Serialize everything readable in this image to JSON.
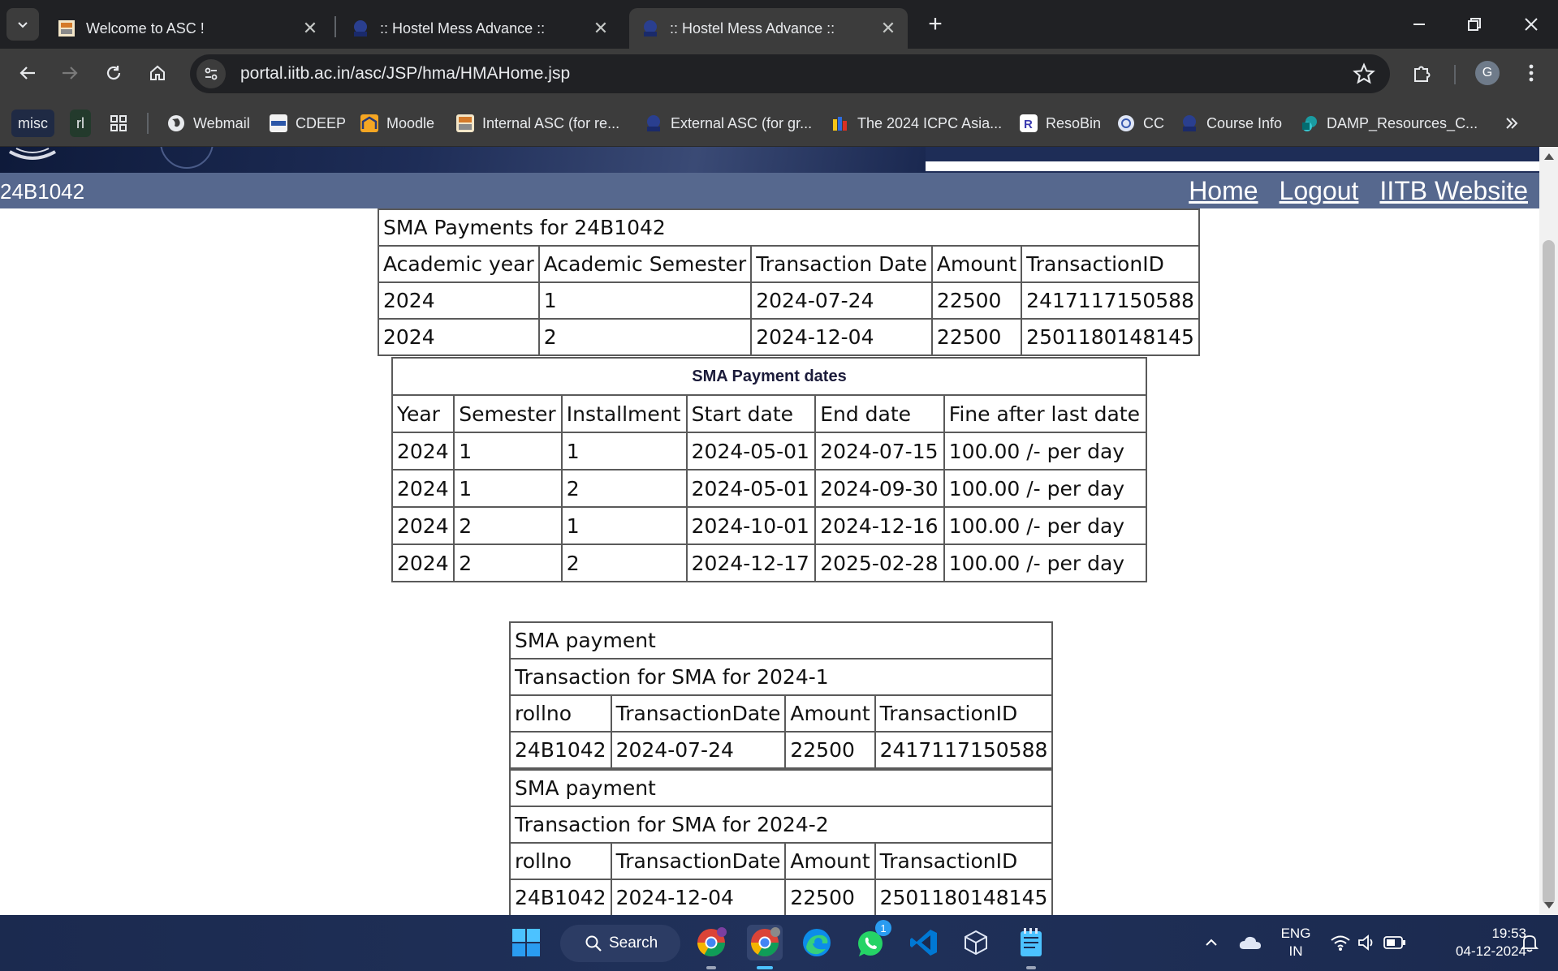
{
  "browser": {
    "tabs": [
      {
        "title": "Welcome to ASC !",
        "active": false
      },
      {
        "title": ":: Hostel Mess Advance ::",
        "active": false
      },
      {
        "title": ":: Hostel Mess Advance ::",
        "active": true
      }
    ],
    "url": "portal.iitb.ac.in/asc/JSP/hma/HMAHome.jsp",
    "profile_initial": "G",
    "bookmarks": [
      "misc",
      "rl",
      "Webmail",
      "CDEEP",
      "Moodle",
      "Internal ASC (for re...",
      "External ASC (for gr...",
      "The 2024 ICPC Asia...",
      "ResoBin",
      "CC",
      "Course Info",
      "DAMP_Resources_C..."
    ]
  },
  "header": {
    "roll_no": "24B1042",
    "links": [
      "Home",
      "Logout",
      "IITB Website"
    ]
  },
  "payments": {
    "title": "SMA Payments for 24B1042",
    "headers": [
      "Academic year",
      "Academic Semester",
      "Transaction Date",
      "Amount",
      "TransactionID"
    ],
    "rows": [
      [
        "2024",
        "1",
        "2024-07-24",
        "22500",
        "2417117150588"
      ],
      [
        "2024",
        "2",
        "2024-12-04",
        "22500",
        "2501180148145"
      ]
    ]
  },
  "payment_dates": {
    "title": "SMA Payment dates",
    "headers": [
      "Year",
      "Semester",
      "Installment",
      "Start date",
      "End date",
      "Fine after last date"
    ],
    "rows": [
      [
        "2024",
        "1",
        "1",
        "2024-05-01",
        "2024-07-15",
        "100.00 /- per day"
      ],
      [
        "2024",
        "1",
        "2",
        "2024-05-01",
        "2024-09-30",
        "100.00 /- per day"
      ],
      [
        "2024",
        "2",
        "1",
        "2024-10-01",
        "2024-12-16",
        "100.00 /- per day"
      ],
      [
        "2024",
        "2",
        "2",
        "2024-12-17",
        "2025-02-28",
        "100.00 /- per day"
      ]
    ]
  },
  "transactions": [
    {
      "title": "SMA payment",
      "subtitle": "Transaction for SMA for 2024-1",
      "headers": [
        "rollno",
        "TransactionDate",
        "Amount",
        "TransactionID"
      ],
      "row": [
        "24B1042",
        "2024-07-24",
        "22500",
        "2417117150588"
      ]
    },
    {
      "title": "SMA payment",
      "subtitle": "Transaction for SMA for 2024-2",
      "headers": [
        "rollno",
        "TransactionDate",
        "Amount",
        "TransactionID"
      ],
      "row": [
        "24B1042",
        "2024-12-04",
        "22500",
        "2501180148145"
      ]
    }
  ],
  "taskbar": {
    "search_label": "Search",
    "whatsapp_badge": "1",
    "language": "ENG",
    "region": "IN",
    "time": "19:53",
    "date": "04-12-2024"
  }
}
